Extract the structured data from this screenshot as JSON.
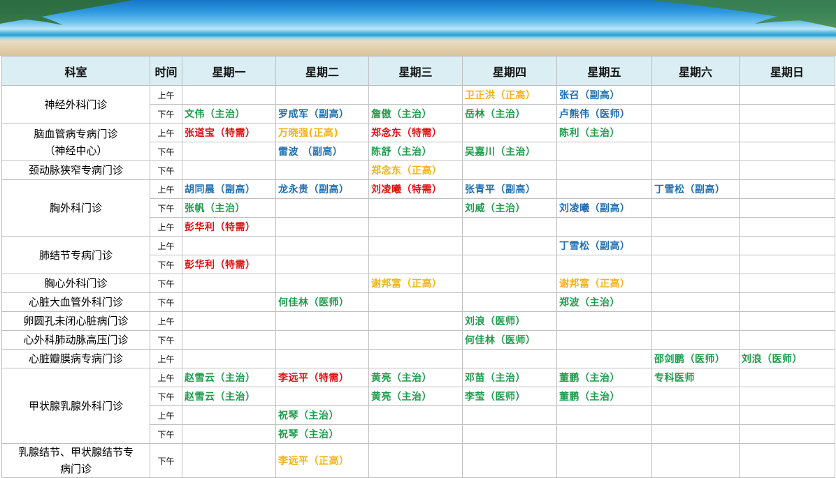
{
  "colors": {
    "green": "#1e9c4c",
    "blue": "#1f6fb2",
    "red": "#e01010",
    "yellow": "#f2b316",
    "header_bg": "#daeef3"
  },
  "header": {
    "dept": "科室",
    "time": "时间",
    "days": [
      "星期一",
      "星期二",
      "星期三",
      "星期四",
      "星期五",
      "星期六",
      "星期日"
    ]
  },
  "rows": [
    {
      "dept": "神经外科门诊",
      "rowspan": 2,
      "time": "上午",
      "cells": [
        null,
        null,
        null,
        {
          "t": "卫正洪（正高）",
          "c": "yellow"
        },
        {
          "t": "张召（副高）",
          "c": "blue"
        },
        null,
        null
      ]
    },
    {
      "time": "下午",
      "cells": [
        {
          "t": "文伟（主治）",
          "c": "green"
        },
        {
          "t": "罗成军（副高）",
          "c": "blue"
        },
        {
          "t": "詹傲（主治）",
          "c": "green"
        },
        {
          "t": "岳林（主治）",
          "c": "green"
        },
        {
          "t": "卢熊伟（医师）",
          "c": "blue"
        },
        null,
        null
      ]
    },
    {
      "dept": "脑血管病专病门诊\n（神经中心）",
      "rowspan": 2,
      "time": "上午",
      "cells": [
        {
          "t": "张道宝（特需）",
          "c": "red"
        },
        {
          "t": "万晓强(正高)",
          "c": "yellow"
        },
        {
          "t": "郑念东（特需）",
          "c": "red"
        },
        null,
        {
          "t": "陈利（主治）",
          "c": "green"
        },
        null,
        null
      ]
    },
    {
      "time": "下午",
      "cells": [
        null,
        {
          "t": "雷波 （副高）",
          "c": "blue"
        },
        {
          "t": "陈舒（主治）",
          "c": "green"
        },
        {
          "t": "吴嘉川（主治）",
          "c": "green"
        },
        null,
        null,
        null
      ]
    },
    {
      "dept": "颈动脉狭窄专病门诊",
      "rowspan": 1,
      "time": "下午",
      "cells": [
        null,
        null,
        {
          "t": "郑念东（正高）",
          "c": "yellow"
        },
        null,
        null,
        null,
        null
      ]
    },
    {
      "dept": "胸外科门诊",
      "rowspan": 3,
      "time": "上午",
      "cells": [
        {
          "t": "胡同晨（副高）",
          "c": "blue"
        },
        {
          "t": "龙永贵（副高）",
          "c": "blue"
        },
        {
          "t": "刘凌曦（特需）",
          "c": "red"
        },
        {
          "t": "张青平（副高）",
          "c": "blue"
        },
        null,
        {
          "t": "丁雪松（副高）",
          "c": "blue"
        },
        null
      ]
    },
    {
      "time": "下午",
      "cells": [
        {
          "t": "张帆（主治）",
          "c": "green"
        },
        null,
        null,
        {
          "t": "刘威（主治）",
          "c": "green"
        },
        {
          "t": "刘凌曦（副高）",
          "c": "blue"
        },
        null,
        null
      ]
    },
    {
      "time": "上午",
      "cells": [
        {
          "t": "彭华利（特需）",
          "c": "red"
        },
        null,
        null,
        null,
        null,
        null,
        null
      ]
    },
    {
      "dept": "肺结节专病门诊",
      "rowspan": 2,
      "time": "上午",
      "cells": [
        null,
        null,
        null,
        null,
        {
          "t": "丁雪松（副高）",
          "c": "blue"
        },
        null,
        null
      ]
    },
    {
      "time": "下午",
      "cells": [
        {
          "t": "彭华利（特需）",
          "c": "red"
        },
        null,
        null,
        null,
        null,
        null,
        null
      ]
    },
    {
      "dept": "胸心外科门诊",
      "rowspan": 1,
      "time": "下午",
      "cells": [
        null,
        null,
        {
          "t": "谢邦富（正高）",
          "c": "yellow"
        },
        null,
        {
          "t": "谢邦富（正高）",
          "c": "yellow"
        },
        null,
        null
      ]
    },
    {
      "dept": "心脏大血管外科门诊",
      "rowspan": 1,
      "time": "下午",
      "cells": [
        null,
        {
          "t": "何佳林（医师）",
          "c": "green"
        },
        null,
        null,
        {
          "t": "郑波（主治）",
          "c": "green"
        },
        null,
        null
      ]
    },
    {
      "dept": "卵圆孔未闭心脏病门诊",
      "rowspan": 1,
      "time": "上午",
      "cells": [
        null,
        null,
        null,
        {
          "t": "刘浪（医师）",
          "c": "green"
        },
        null,
        null,
        null
      ]
    },
    {
      "dept": "心外科肺动脉高压门诊",
      "rowspan": 1,
      "time": "下午",
      "cells": [
        null,
        null,
        null,
        {
          "t": "何佳林（医师）",
          "c": "green"
        },
        null,
        null,
        null
      ]
    },
    {
      "dept": "心脏瓣膜病专病门诊",
      "rowspan": 1,
      "time": "上午",
      "cells": [
        null,
        null,
        null,
        null,
        null,
        {
          "t": "邵剑鹏（医师）",
          "c": "green"
        },
        {
          "t": "刘浪（医师）",
          "c": "green"
        }
      ]
    },
    {
      "dept": "甲状腺乳腺外科门诊",
      "rowspan": 4,
      "time": "上午",
      "cells": [
        {
          "t": "赵雪云（主治）",
          "c": "green"
        },
        {
          "t": "李远平（特需）",
          "c": "red"
        },
        {
          "t": "黄亮（主治）",
          "c": "green"
        },
        {
          "t": "邓苗（主治）",
          "c": "green"
        },
        {
          "t": "董鹏（主治）",
          "c": "green"
        },
        {
          "t": "专科医师",
          "c": "green"
        },
        null
      ]
    },
    {
      "time": "下午",
      "cells": [
        {
          "t": "赵雪云（主治）",
          "c": "green"
        },
        null,
        {
          "t": "黄亮（主治）",
          "c": "green"
        },
        {
          "t": "李莹（医师）",
          "c": "green"
        },
        {
          "t": "董鹏（主治）",
          "c": "green"
        },
        null,
        null
      ]
    },
    {
      "time": "上午",
      "cells": [
        null,
        {
          "t": "祝琴（主治）",
          "c": "green"
        },
        null,
        null,
        null,
        null,
        null
      ]
    },
    {
      "time": "下午",
      "cells": [
        null,
        {
          "t": "祝琴（主治）",
          "c": "green"
        },
        null,
        null,
        null,
        null,
        null
      ]
    },
    {
      "dept": "乳腺结节、甲状腺结节专\n病门诊",
      "rowspan": 1,
      "time": "下午",
      "cells": [
        null,
        {
          "t": "李远平（正高）",
          "c": "yellow"
        },
        null,
        null,
        null,
        null,
        null
      ]
    }
  ]
}
